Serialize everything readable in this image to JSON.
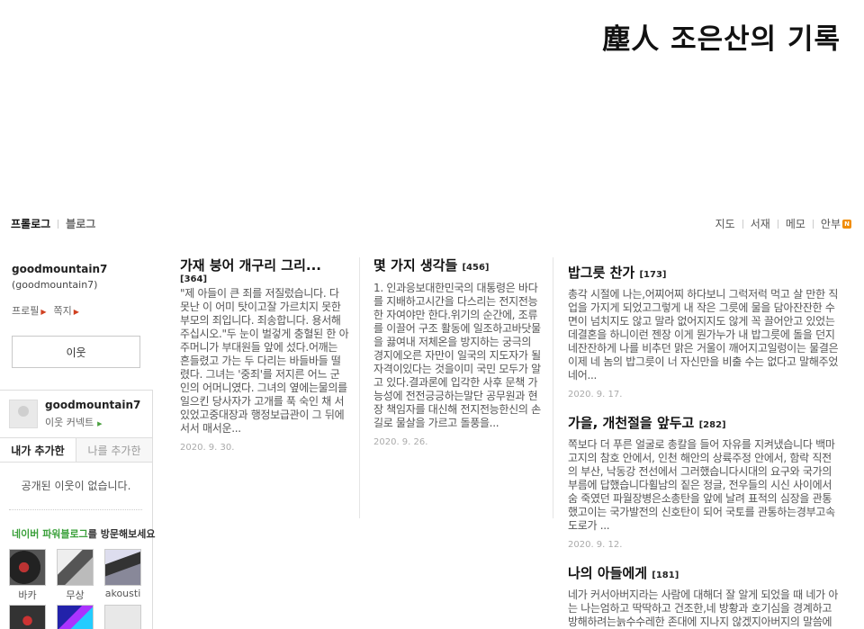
{
  "blog_title": "塵人 조은산의 기록",
  "nav_left": [
    "프롤로그",
    "블로그"
  ],
  "nav_right": [
    "지도",
    "서재",
    "메모",
    "안부"
  ],
  "nav_badge": "N",
  "profile": {
    "id": "goodmountain7",
    "id_sub": "(goodmountain7)",
    "links": [
      "프로필",
      "쪽지"
    ],
    "neighbor_button": "이웃"
  },
  "neighbor_box": {
    "name": "goodmountain7",
    "comment": "이웃 커넥트",
    "tabs": [
      "내가 추가한",
      "나를 추가한"
    ],
    "empty_text": "공개된 이웃이 없습니다.",
    "powerblog_green": "네이버 파워블로그",
    "powerblog_rest": "를 방문해보세요",
    "thumbs": [
      "바카",
      "무상",
      "akousti"
    ]
  },
  "posts": [
    {
      "title": "가재 붕어 개구리 그리...",
      "count": "[364]",
      "body": "\"제 아들이 큰 죄를 저질렀습니다. 다 못난 이 어미 탓이고잘 가르치지 못한 부모의 죄입니다. 죄송합니다. 용서해 주십시오.\"두 눈이 벌겋게 충혈된 한 아주머니가 부대원들 앞에 섰다.어깨는 흔들렸고 가는 두 다리는 바들바들 떨렸다. 그녀는 '중죄'를 저지른 어느 군인의 어머니였다. 그녀의 옆에는물의를 일으킨 당사자가 고개를 푹 숙인 채 서있었고중대장과 행정보급관이 그 뒤에 서서 매서운...",
      "date": "2020. 9. 30."
    },
    {
      "title": "몇 가지 생각들",
      "count": "[456]",
      "body": "1. 인과응보대한민국의 대통령은 바다를 지배하고시간을 다스리는 전지전능한 자여야만 한다.위기의 순간에, 조류를 이끌어 구조 활동에 일조하고바닷물을 끓여내 저체온을 방지하는 궁극의 경지에오른 자만이 일국의 지도자가 될 자격이있다는 것을이미 국민 모두가 알고 있다.결과론에 입각한 사후 문책 가능성에 전전긍긍하는말단 공무원과 현장 책임자를 대신해 전지전능한신의 손길로 물살을 가르고 돌풍을...",
      "date": "2020. 9. 26."
    }
  ],
  "right_posts": [
    {
      "title": "밥그릇 찬가",
      "count": "[173]",
      "body": "총각 시절에 나는,어찌어찌 하다보니 그럭저럭 먹고 살 만한 직업을 가지게 되었고그렇게 내 작은 그릇에 물을 담아잔잔한 수면이 넘치지도 않고 말라 없어지지도 않게 꼭 끌어안고 있었는데결혼을 하니이런 젠장 이게 뭔가누가 내 밥그릇에 돌을 던지네잔잔하게 나를 비추던 맑은 거울이 깨어지고일렁이는 물결은 이제 네 놈의 밥그릇이 너 자신만을 비출 수는 없다고 말해주었네어...",
      "date": "2020. 9. 17."
    },
    {
      "title": "가을, 개천절을 앞두고",
      "count": "[282]",
      "body": "쪽보다 더 푸른 얼굴로 총칼을 들어 자유를 지켜냈습니다 백마고지의 참호 안에서, 인천 해안의 상륙주정 안에서, 함락 직전의 부산, 낙동강 전선에서 그러했습니다시대의 요구와 국가의 부름에 답했습니다휠남의 짙은 정글, 전우들의 시신 사이에서 숨 죽였던 파월장병은소총탄을 앞에 날려 표적의 심장을 관통했고이는 국가발전의 신호탄이 되어 국토를 관통하는경부고속도로가 ...",
      "date": "2020. 9. 12."
    },
    {
      "title": "나의 아들에게",
      "count": "[181]",
      "body": "네가 커서아버지라는 사람에 대해더 잘 알게 되었을 때 네가 아는 나는엄하고 딱딱하고 건조한,네 방황과 호기심을 경계하고 방해하려는늙수수레한 존대에 지나지 않겠지아버지의 말씀에 성의없는 대답으로 일관하며아버",
      "date": ""
    }
  ]
}
